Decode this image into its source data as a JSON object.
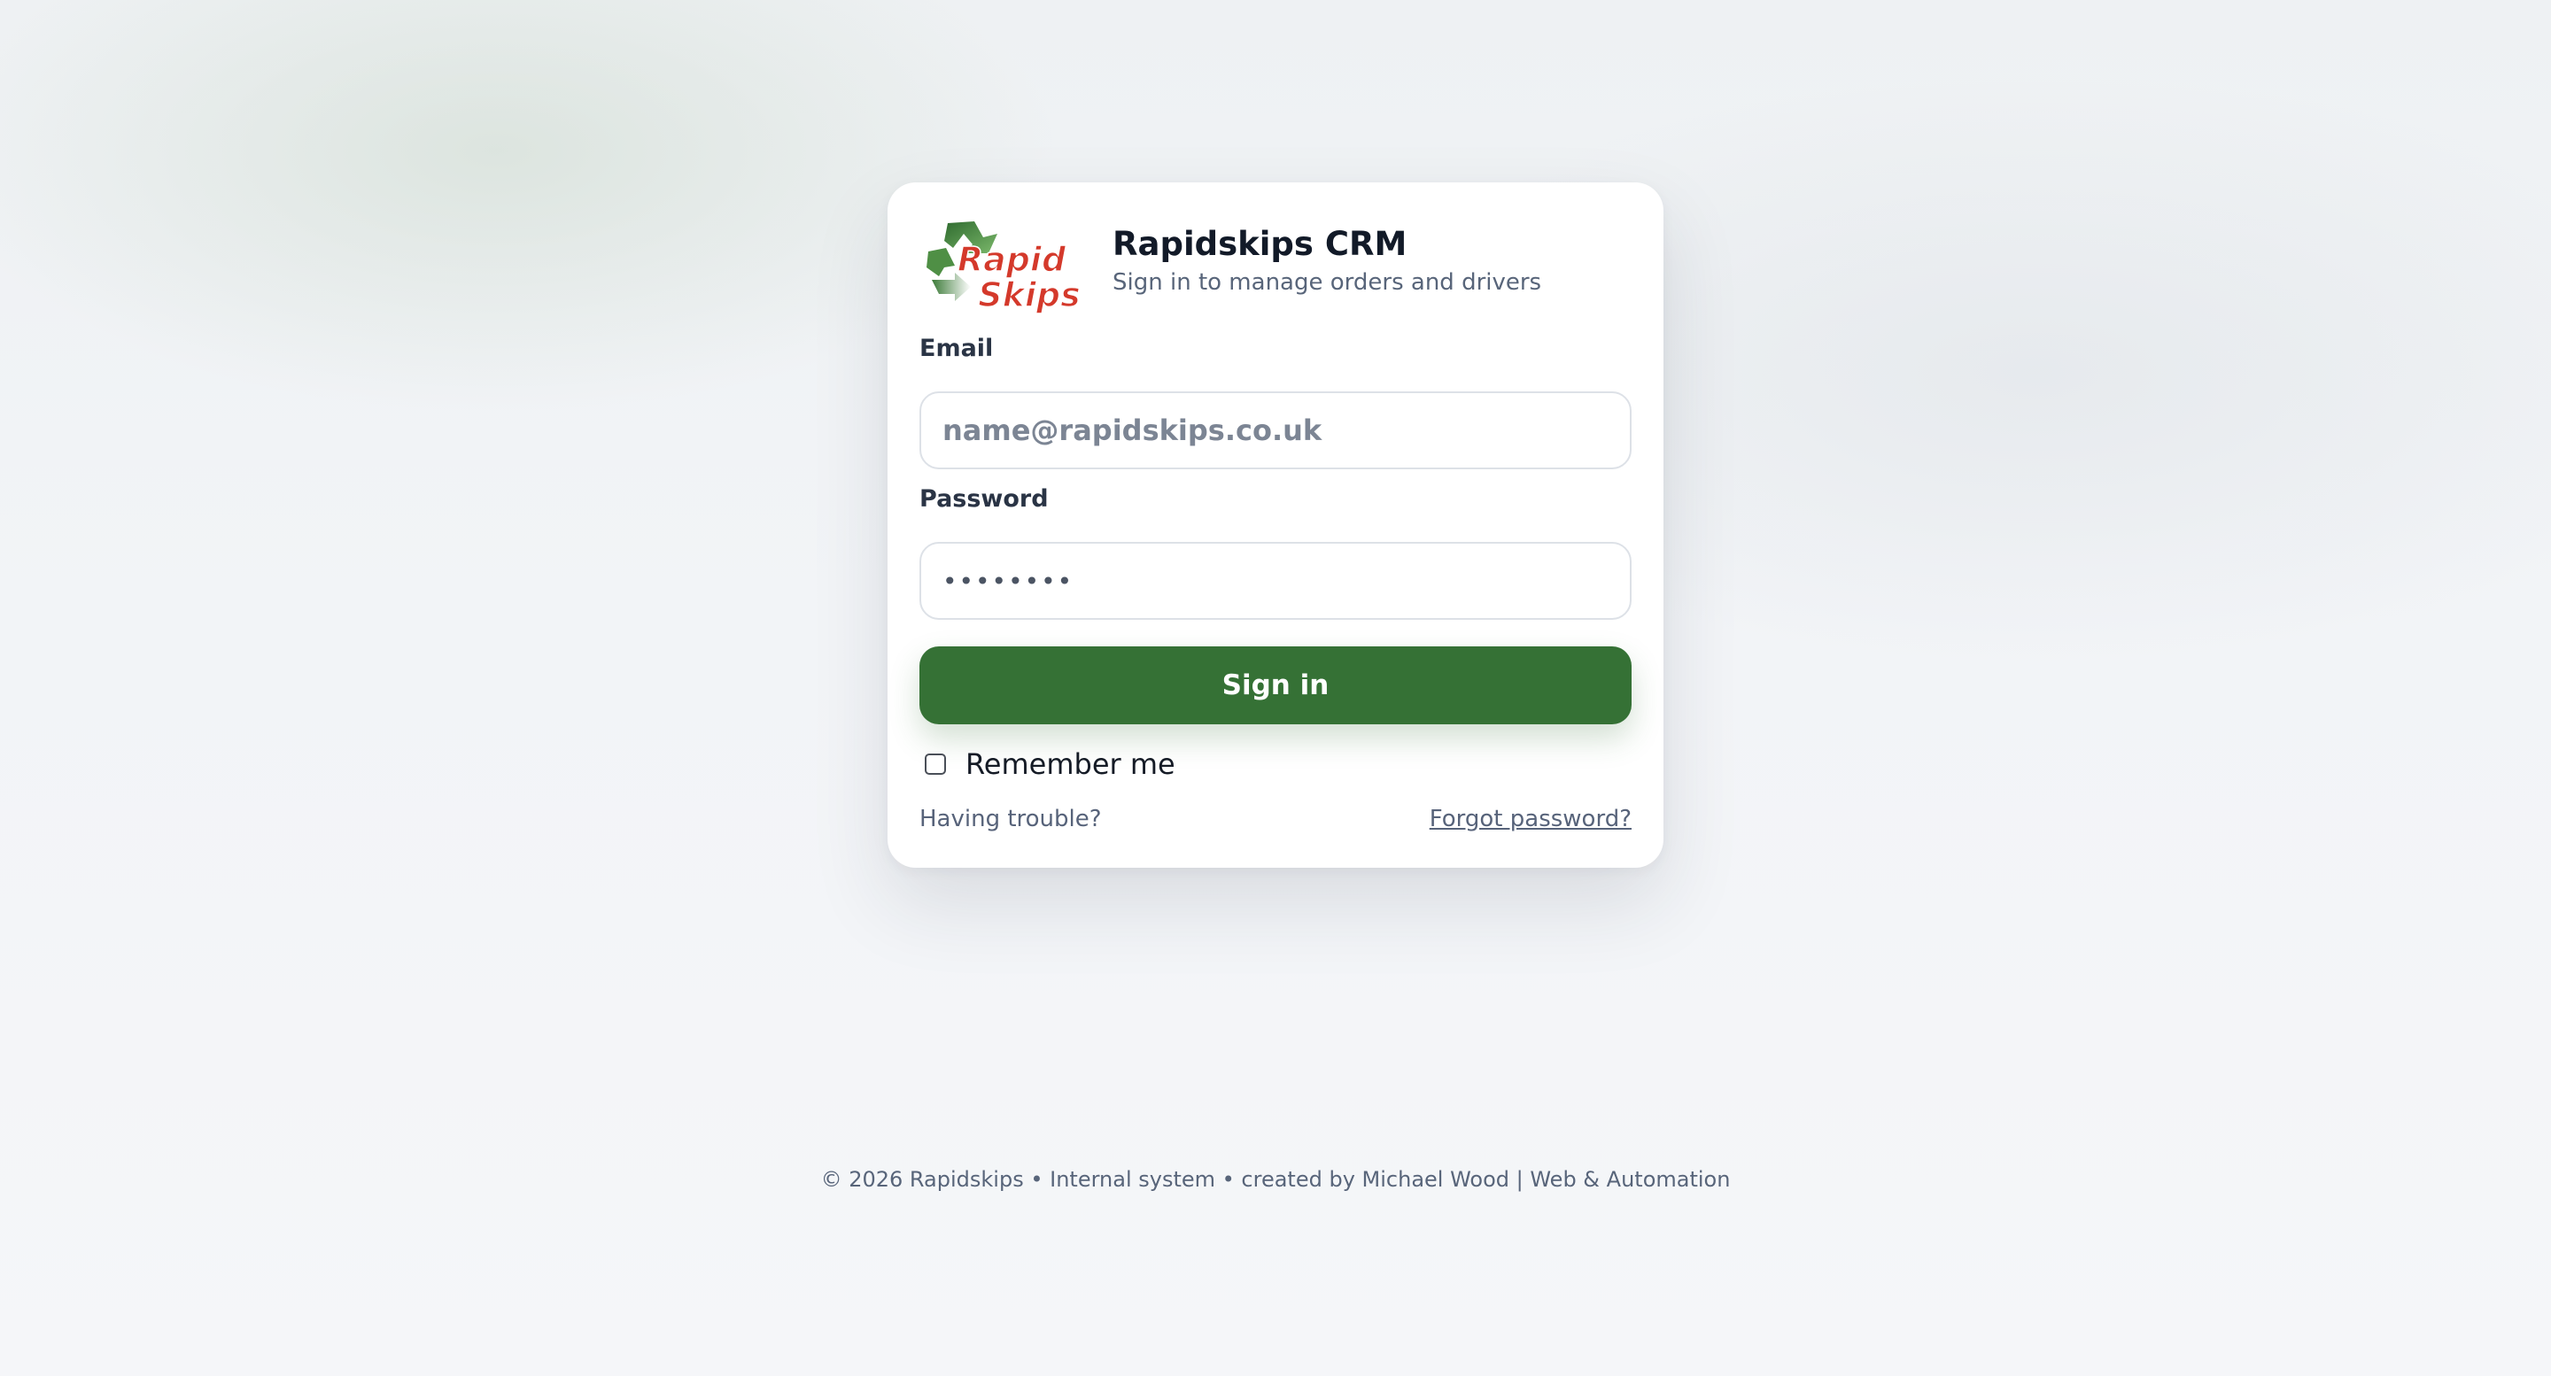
{
  "app": {
    "title": "Rapidskips CRM",
    "subtitle": "Sign in to manage orders and drivers",
    "logo_text_line1": "Rapid",
    "logo_text_line2": "Skips"
  },
  "form": {
    "email_label": "Email",
    "email_placeholder": "name@rapidskips.co.uk",
    "email_value": "",
    "password_label": "Password",
    "password_value": "••••••••",
    "submit_label": "Sign in",
    "remember_label": "Remember me",
    "remember_checked": false,
    "trouble_text": "Having trouble?",
    "forgot_link": "Forgot password?"
  },
  "footer": {
    "text": "© 2026 Rapidskips • Internal system • created by Michael Wood | Web & Automation"
  },
  "colors": {
    "primary_button": "#357135",
    "logo_red": "#d4392b",
    "logo_green": "#3f7d3a"
  }
}
